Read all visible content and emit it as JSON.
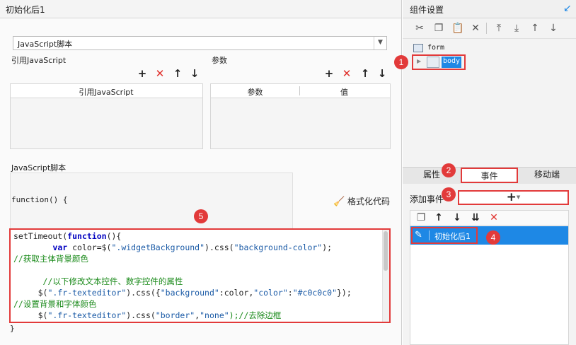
{
  "left": {
    "title": "初始化后1",
    "type_select": "JavaScript脚本",
    "ref_js_label": "引用JavaScript",
    "params_label": "参数",
    "ref_grid_header": "引用JavaScript",
    "params_grid_headers": [
      "参数",
      "值"
    ],
    "script_label": "JavaScript脚本",
    "fn_open": "function() {",
    "format_button": "格式化代码",
    "fn_close": "}",
    "code": [
      [
        "setTimeout(",
        "function",
        "(){"
      ],
      [
        "        ",
        "var",
        " color=$(",
        "\".widgetBackground\"",
        ").css(",
        "\"background-color\"",
        ");"
      ],
      [
        "//获取主体背景颜色"
      ],
      [
        ""
      ],
      [
        "      //以下修改文本控件、数字控件的属性"
      ],
      [
        "     $(",
        "\".fr-texteditor\"",
        ").css({",
        "\"background\"",
        ":color,",
        "\"color\"",
        ":",
        "\"#c0c0c0\"",
        "});"
      ],
      [
        "//设置背景和字体颜色"
      ],
      [
        "     $(",
        "\".fr-texteditor\"",
        ").css(",
        "\"border\"",
        ",",
        "\"none\"",
        ");//去除边框"
      ]
    ]
  },
  "right": {
    "title": "组件设置",
    "tree": [
      "form",
      "body"
    ],
    "tabs": [
      "属性",
      "事件",
      "移动端"
    ],
    "add_event_label": "添加事件",
    "add_event_button": "+",
    "event_item": "初始化后1"
  },
  "badges": [
    "1",
    "2",
    "3",
    "4",
    "5"
  ],
  "colors": {
    "highlight_red": "#e23a3a",
    "selection_blue": "#1e88e5",
    "badge_red": "#e23a3a"
  }
}
